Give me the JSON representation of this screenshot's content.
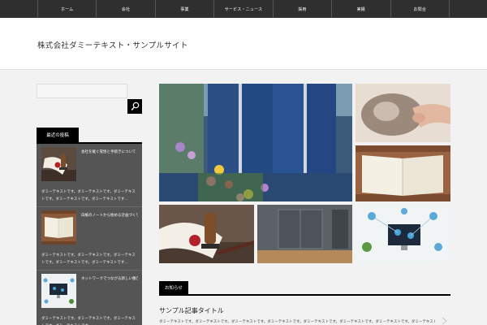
{
  "nav": {
    "items": [
      "ホーム",
      "会社",
      "事業",
      "サービス・ニュース",
      "採用",
      "実績",
      "お問合"
    ]
  },
  "header": {
    "site_title": "株式会社ダミーテキスト・サンプルサイト"
  },
  "search": {
    "placeholder": "",
    "icon": "search-icon"
  },
  "sidebar": {
    "widget_title": "最近の投稿",
    "posts": [
      {
        "title": "会社を継ぐ覚悟と手続きについて",
        "excerpt": "ダミーテキストです。ダミーテキストです。ダミーテキストです。ダミーテキストです。ダミーテキストです…"
      },
      {
        "title": "白紙のノートから始める計画づくり",
        "excerpt": "ダミーテキストです。ダミーテキストです。ダミーテキストです。ダミーテキストです。ダミーテキストです…"
      },
      {
        "title": "ネットワークでつながる新しい働き方",
        "excerpt": "ダミーテキストです。ダミーテキストです。ダミーテキストです。ダミーテキストです。"
      }
    ]
  },
  "main": {
    "section_label": "お知らせ",
    "news": {
      "title": "サンプル記事タイトル",
      "excerpt": "ダミーテキストです。ダミーテキストです。ダミーテキストです。ダミーテキストです。ダミーテキストです。ダミーテキストです。ダミーテキストです。ダミーテキストです。ダミーテキストです。ダミー100文字"
    }
  }
}
